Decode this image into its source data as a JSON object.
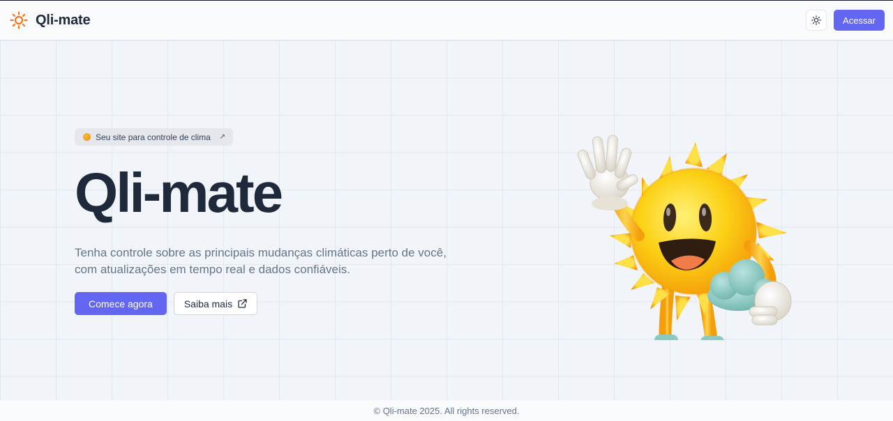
{
  "header": {
    "brand_name": "Qli-mate",
    "brand_icon": "sun-icon",
    "theme_toggle_icon": "sun-icon",
    "login_label": "Acessar"
  },
  "hero": {
    "badge_text": "Seu site para controle de clima",
    "badge_icon": "arrow-up-right-icon",
    "title": "Qli-mate",
    "lead_line1": "Tenha controle sobre as principais mudanças climáticas perto de você,",
    "lead_line2": "com atualizações em tempo real e dados confiáveis.",
    "primary_cta": "Comece agora",
    "secondary_cta": "Saiba mais",
    "secondary_cta_icon": "external-link-icon",
    "illustration": "waving-sun-mascot"
  },
  "footer": {
    "copyright": "© Qli-mate 2025. All rights reserved."
  },
  "colors": {
    "accent": "#6366f1",
    "brand_sun": "#f97316",
    "background": "#f1f5f9",
    "heading": "#1e293b",
    "muted_text": "#64748b"
  }
}
